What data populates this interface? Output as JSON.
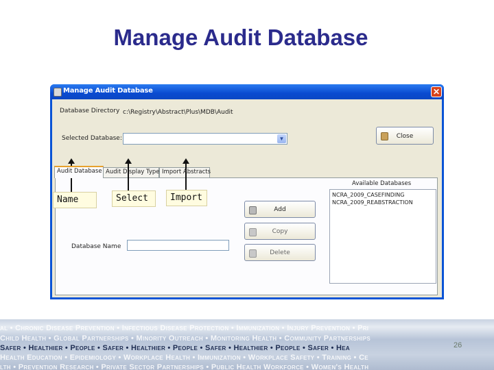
{
  "slide": {
    "title": "Manage Audit Database",
    "number": "26"
  },
  "window": {
    "title": "Manage Audit Database",
    "close_glyph": "✕",
    "database_directory_label": "Database Directory",
    "database_directory_value": "c:\\Registry\\Abstract\\Plus\\MDB\\Audit",
    "selected_database_label": "Selected Database:",
    "selected_database_value": "",
    "close_button_label": "Close",
    "tabs": [
      {
        "label": "Audit Database",
        "active": true
      },
      {
        "label": "Audit Display Type",
        "active": false
      },
      {
        "label": "Import Abstracts",
        "active": false
      }
    ],
    "database_name_label": "Database Name",
    "database_name_value": "",
    "available_databases_label": "Available Databases",
    "available_databases": [
      "NCRA_2009_CASEFINDING",
      "NCRA_2009_REABSTRACTION"
    ],
    "buttons": {
      "add": "Add",
      "copy": "Copy",
      "delete": "Delete"
    },
    "icons": {
      "window": "database-icon",
      "close": "door-icon",
      "add": "add-database-icon",
      "copy": "copy-database-icon",
      "delete": "delete-database-icon"
    }
  },
  "callouts": {
    "name": "Name",
    "select": "Select",
    "import": "Import"
  },
  "footer": {
    "lines": [
      "al • Chronic Disease Prevention • Infectious Disease Protection • Immunization • Injury Prevention • Pri",
      "Child Health • Global Partnerships • Minority Outreach • Monitoring Health • Community Partnerships",
      "Safer • Healthier • People • Safer • Healthier • People • Safer • Healthier • People • Safer • Hea",
      "Health Education • Epidemiology • Workplace Health • Immunization • Workplace Safety • Training • Ce",
      "lth • Prevention Research • Private Sector Partnerships • Public Health Workforce • Women's Health"
    ]
  },
  "colors": {
    "title": "#2b2b8c",
    "xp_blue": "#0a54d6",
    "dialog_face": "#ece9d8",
    "footer_text": "#1e2d52"
  }
}
